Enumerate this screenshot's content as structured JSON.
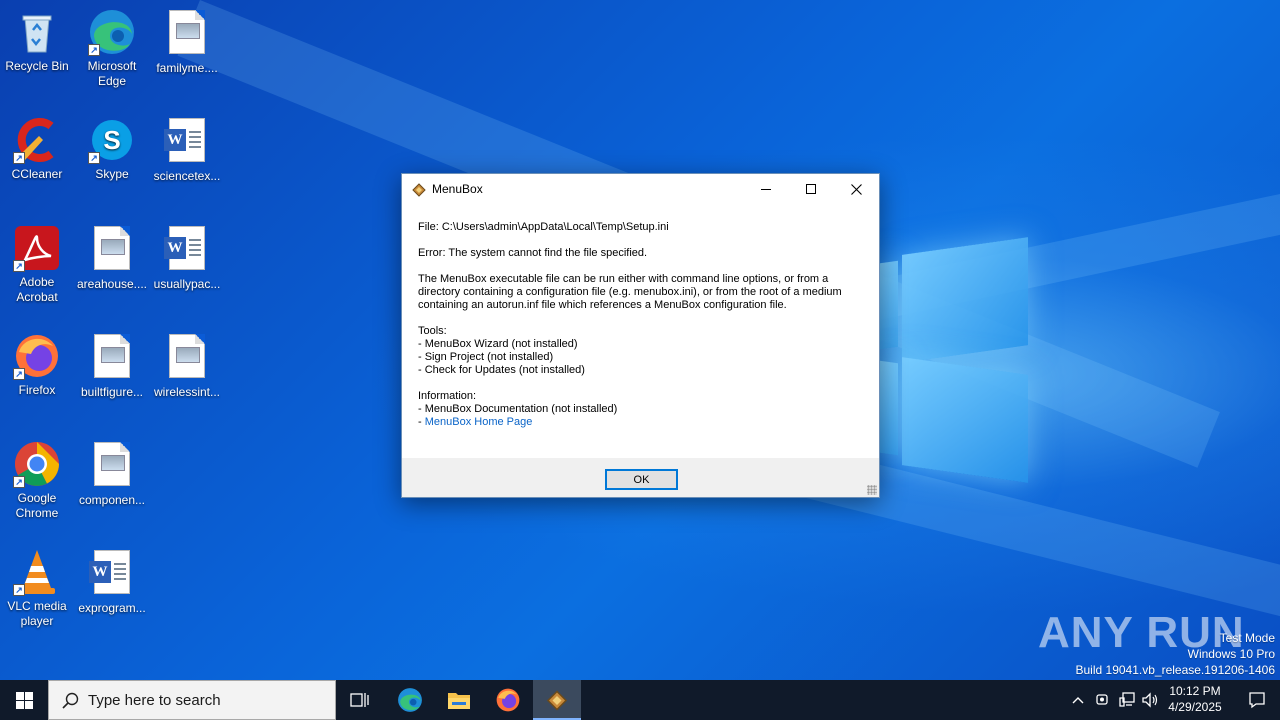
{
  "desktop": {
    "icons": [
      {
        "label": "Recycle Bin"
      },
      {
        "label": "Microsoft Edge"
      },
      {
        "label": "familyme...."
      },
      {
        "label": "CCleaner"
      },
      {
        "label": "Skype"
      },
      {
        "label": "sciencetex..."
      },
      {
        "label": "Adobe Acrobat"
      },
      {
        "label": "areahouse...."
      },
      {
        "label": "usuallypac..."
      },
      {
        "label": "Firefox"
      },
      {
        "label": "builtfigure..."
      },
      {
        "label": "wirelessint..."
      },
      {
        "label": "Google Chrome"
      },
      {
        "label": "componen..."
      },
      {
        "label": "VLC media player"
      },
      {
        "label": "exprogram..."
      }
    ]
  },
  "dialog": {
    "title": "MenuBox",
    "file_line": "File: C:\\Users\\admin\\AppData\\Local\\Temp\\Setup.ini",
    "error_line": "Error: The system cannot find the file specified.",
    "description": "The MenuBox executable file can be run either with command line options, or from a directory containing a configuration file (e.g. menubox.ini), or from the root of a medium containing an autorun.inf file which references a MenuBox configuration file.",
    "tools_header": "Tools:",
    "tools": [
      "- MenuBox Wizard (not installed)",
      "- Sign Project (not installed)",
      "- Check for Updates (not installed)"
    ],
    "info_header": "Information:",
    "info_doc": "- MenuBox Documentation (not installed)",
    "info_link_prefix": "- ",
    "info_link": "MenuBox Home Page",
    "ok_label": "OK"
  },
  "watermark": {
    "logo": "ANY RUN",
    "mode": "Test Mode",
    "edition": "Windows 10 Pro",
    "build": "Build 19041.vb_release.191206-1406"
  },
  "taskbar": {
    "search_placeholder": "Type here to search",
    "time": "10:12 PM",
    "date": "4/29/2025"
  },
  "colors": {
    "link": "#0a64c8",
    "ok_border": "#0078d7",
    "taskbar": "#101a2a"
  }
}
